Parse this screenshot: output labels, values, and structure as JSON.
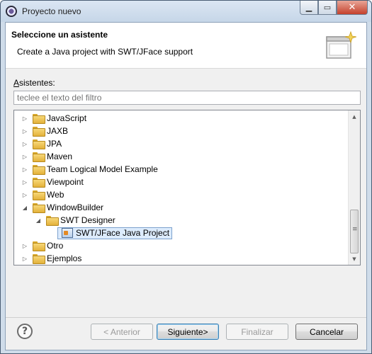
{
  "window": {
    "title": "Proyecto nuevo"
  },
  "header": {
    "title": "Seleccione un asistente",
    "description": "Create a Java project with SWT/JFace support"
  },
  "wizards": {
    "label_prefix": "A",
    "label_rest": "sistentes:",
    "filter_placeholder": "teclee el texto del filtro"
  },
  "tree": {
    "items": [
      {
        "label": "JavaScript",
        "expanded": false
      },
      {
        "label": "JAXB",
        "expanded": false
      },
      {
        "label": "JPA",
        "expanded": false
      },
      {
        "label": "Maven",
        "expanded": false
      },
      {
        "label": "Team Logical Model Example",
        "expanded": false
      },
      {
        "label": "Viewpoint",
        "expanded": false
      },
      {
        "label": "Web",
        "expanded": false
      },
      {
        "label": "WindowBuilder",
        "expanded": true
      },
      {
        "label": "SWT Designer",
        "expanded": true
      },
      {
        "label": "SWT/JFace Java Project",
        "selected": true
      },
      {
        "label": "Otro",
        "expanded": false
      },
      {
        "label": "Ejemplos",
        "expanded": false
      }
    ]
  },
  "buttons": {
    "back": "< Anterior",
    "next": "Siguiente>",
    "finish": "Finalizar",
    "cancel": "Cancelar"
  },
  "icons": {
    "help": "help-icon",
    "folder": "folder-icon",
    "project": "java-project-icon"
  }
}
